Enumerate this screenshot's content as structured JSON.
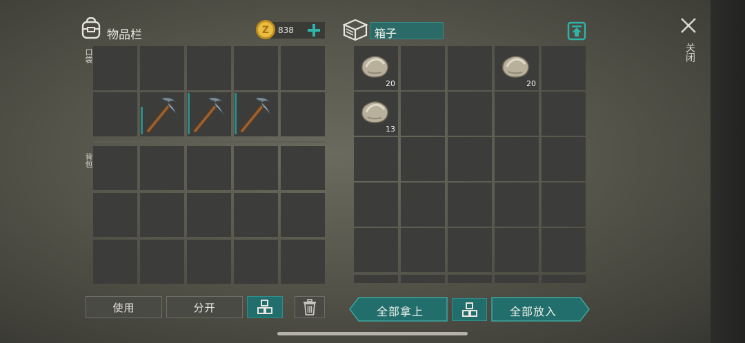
{
  "inventory": {
    "title": "物品栏",
    "currency": "838",
    "pocket_label": "口袋",
    "backpack_label": "背包"
  },
  "container": {
    "title": "箱子",
    "items": [
      {
        "name": "stone",
        "count": "20"
      },
      {
        "name": "stone",
        "count": "20"
      },
      {
        "name": "stone",
        "count": "13"
      }
    ]
  },
  "buttons": {
    "use": "使用",
    "split": "分开",
    "take_all": "全部拿上",
    "put_all": "全部放入"
  },
  "close": {
    "label": "关闭"
  },
  "colors": {
    "accent": "#226e6c",
    "slot": "#3c3d3a",
    "coin": "#e2b43a"
  },
  "icons": [
    "backpack-icon",
    "coin-icon",
    "plus-icon",
    "box-icon",
    "upload-icon",
    "close-icon",
    "sort-icon",
    "trash-icon",
    "pickaxe-icon",
    "stone-icon"
  ]
}
